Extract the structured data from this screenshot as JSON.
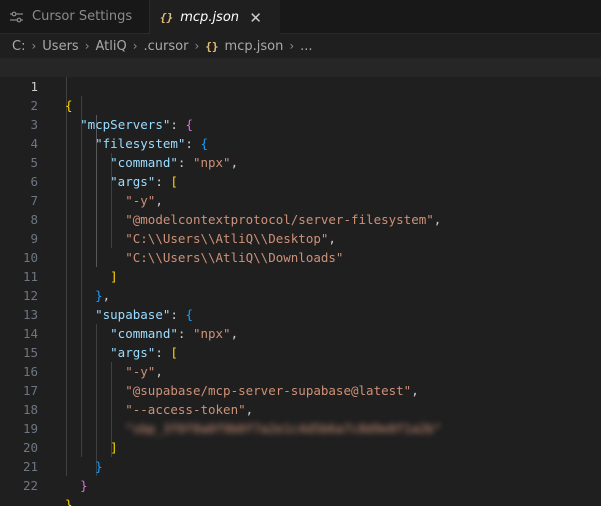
{
  "tabs": {
    "settings": {
      "label": "Cursor Settings",
      "icon": "settings-sliders-icon"
    },
    "active": {
      "label": "mcp.json",
      "icon": "json-braces-icon",
      "close_glyph": "✕"
    }
  },
  "breadcrumb": {
    "items": [
      "C:",
      "Users",
      "AtliQ",
      ".cursor",
      "mcp.json",
      "..."
    ],
    "separator": "›",
    "json_icon_glyph": "{}"
  },
  "editor": {
    "current_line": 1,
    "line_numbers": [
      "1",
      "2",
      "3",
      "4",
      "5",
      "6",
      "7",
      "8",
      "9",
      "10",
      "11",
      "12",
      "13",
      "14",
      "15",
      "16",
      "17",
      "18",
      "19",
      "20",
      "21",
      "22"
    ],
    "text": {
      "open_root": "{",
      "mcpServers": "\"mcpServers\"",
      "filesystem": "\"filesystem\"",
      "command_key": "\"command\"",
      "npx": "\"npx\"",
      "args_key": "\"args\"",
      "dash_y": "\"-y\"",
      "fs_pkg": "\"@modelcontextprotocol/server-filesystem\"",
      "desktop_path": "\"C:\\\\Users\\\\AtliQ\\\\Desktop\"",
      "downloads_path": "\"C:\\\\Users\\\\AtliQ\\\\Downloads\"",
      "supabase": "\"supabase\"",
      "supabase_pkg": "\"@supabase/mcp-server-supabase@latest\"",
      "access_token_flag": "\"--access-token\"",
      "redacted_token": "\"sbp_3f0f8a0f9b0f7a2e1c4d5b6a7c8d9e0f1a2b\"",
      "close_root": "}"
    }
  },
  "colors": {
    "background": "#1f1f1f",
    "key": "#9cdcfe",
    "string": "#ce9178",
    "bracket_level1": "#ffd700",
    "bracket_level2": "#da70d6",
    "bracket_level3": "#179fff"
  }
}
